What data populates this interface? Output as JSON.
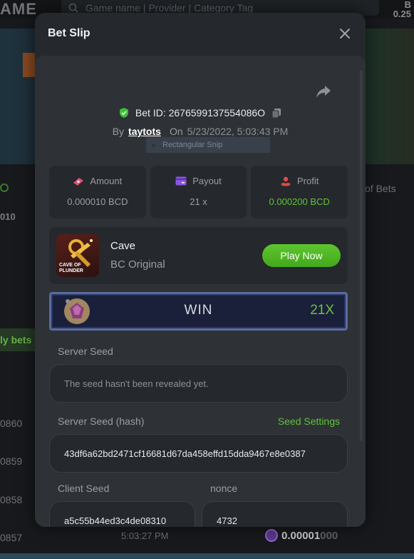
{
  "background": {
    "brand": "AME",
    "search_placeholder": "Game name | Provider | Category Tag",
    "balance_top": "B",
    "balance_bottom": "0.25",
    "of_bets": "of Bets",
    "left_value": "010",
    "my_bets_tab": "ly bets",
    "row_ids": [
      "0860",
      "0859",
      "0858",
      "0857"
    ],
    "row_time": "5:03:27 PM",
    "row_amount_main": "0.00001",
    "row_amount_dim": "000"
  },
  "modal": {
    "title": "Bet Slip",
    "bet_id_label": "Bet ID: 2676599137554086O",
    "by_label": "By",
    "username": "taytots",
    "on_label": "On",
    "date": "5/23/2022, 5:03:43 PM",
    "snip_label": "Rectangular Snip",
    "stats": [
      {
        "label": "Amount",
        "value": "0.000010 BCD",
        "icon": "money-icon"
      },
      {
        "label": "Payout",
        "value": "21 x",
        "icon": "card-icon"
      },
      {
        "label": "Profit",
        "value": "0.000200 BCD",
        "icon": "profit-icon"
      }
    ],
    "game": {
      "name": "Cave",
      "type": "BC Original",
      "thumb_text": "CAVE OF PLUNDER",
      "play_label": "Play Now"
    },
    "result": {
      "label": "WIN",
      "multiplier": "21X"
    },
    "server_seed": {
      "label": "Server Seed",
      "value": "The seed hasn't been revealed yet."
    },
    "server_seed_hash": {
      "label": "Server Seed (hash)",
      "settings_link": "Seed Settings",
      "value": "43df6a62bd2471cf16681d67da458effd15dda9467e8e0387"
    },
    "client_seed": {
      "label": "Client Seed",
      "value": "a5c55b44ed3c4de08310"
    },
    "nonce": {
      "label": "nonce",
      "value": "4732"
    }
  },
  "colors": {
    "accent_green": "#5fc43a",
    "modal_bg": "#25282c",
    "panel_bg": "#2e3135"
  }
}
